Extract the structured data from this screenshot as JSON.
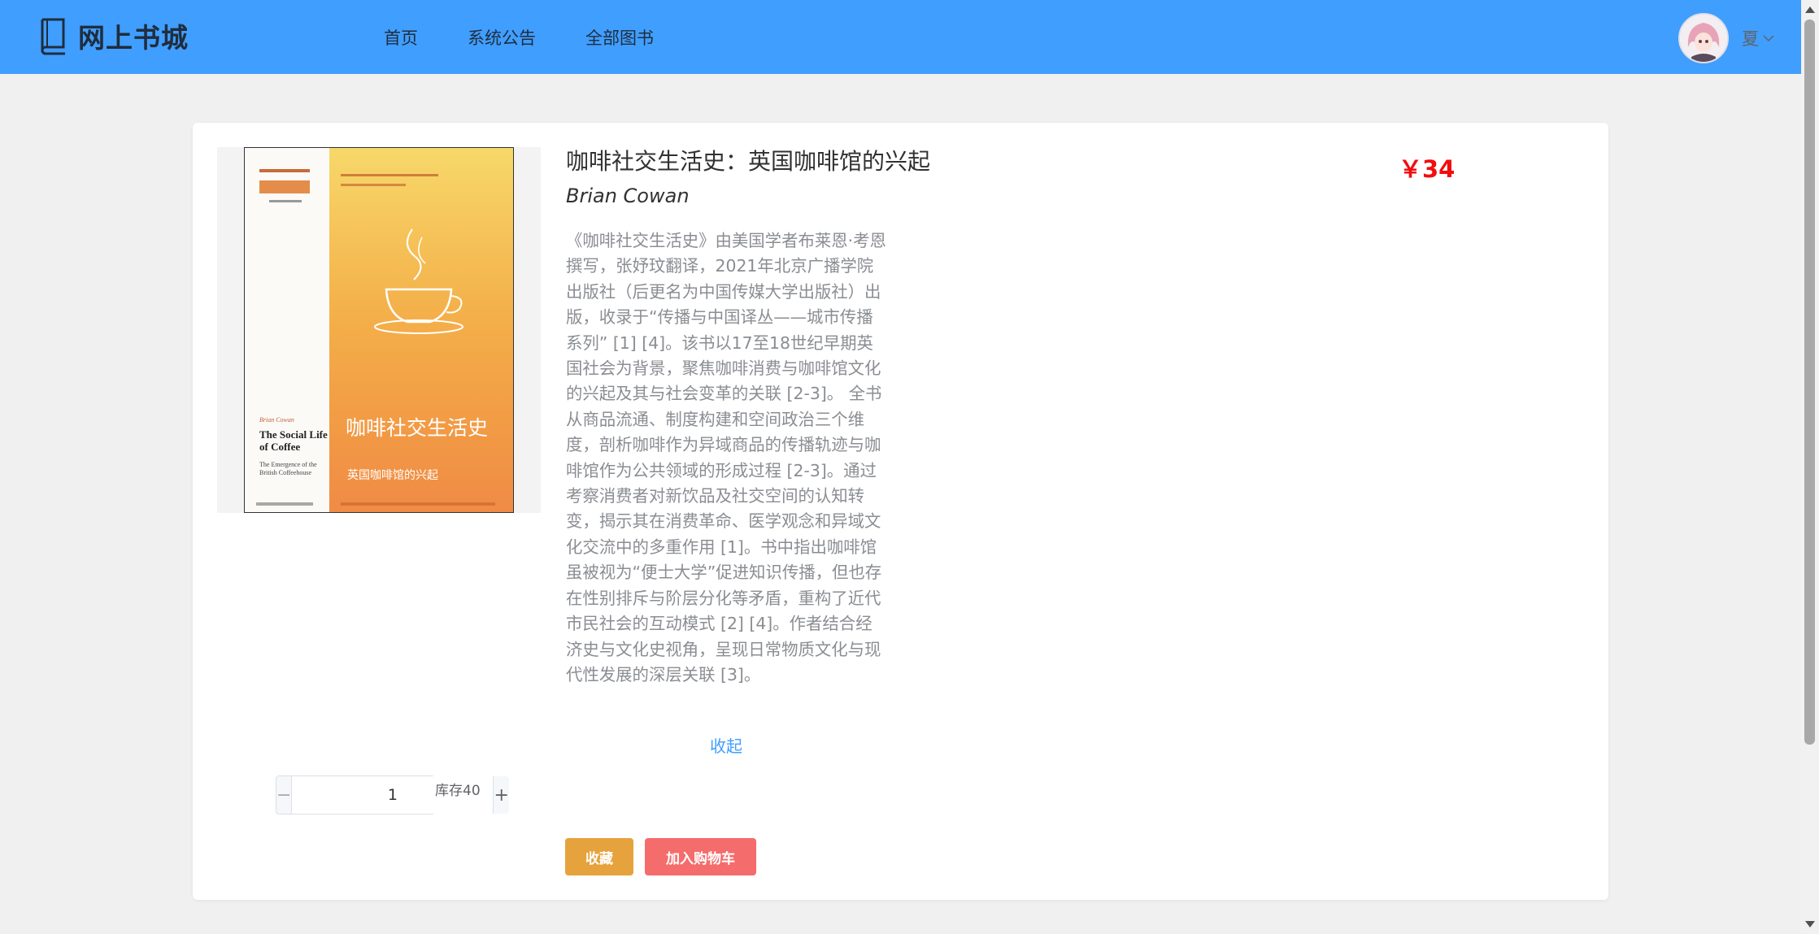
{
  "header": {
    "logo_text": "网上书城",
    "nav": [
      "首页",
      "系统公告",
      "全部图书"
    ],
    "user_name": "夏"
  },
  "book": {
    "title": "咖啡社交生活史：英国咖啡馆的兴起",
    "author": "Brian Cowan",
    "price": "￥34",
    "description": "《咖啡社交生活史》由美国学者布莱恩·考恩撰写，张妤玟翻译，2021年北京广播学院出版社（后更名为中国传媒大学出版社）出版，收录于“传播与中国译丛——城市传播系列” [1] [4]。该书以17至18世纪早期英国社会为背景，聚焦咖啡消费与咖啡馆文化的兴起及其与社会变革的关联 [2-3]。 全书从商品流通、制度构建和空间政治三个维度，剖析咖啡作为异域商品的传播轨迹与咖啡馆作为公共领域的形成过程 [2-3]。通过考察消费者对新饮品及社交空间的认知转变，揭示其在消费革命、医学观念和异域文化交流中的多重作用 [1]。书中指出咖啡馆虽被视为“便士大学”促进知识传播，但也存在性别排斥与阶层分化等矛盾，重构了近代市民社会的互动模式 [2] [4]。作者结合经济史与文化史视角，呈现日常物质文化与现代性发展的深层关联 [3]。",
    "collapse_label": "收起",
    "cover": {
      "cn_title": "咖啡社交生活史",
      "cn_subtitle": "英国咖啡馆的兴起",
      "en_title": "The Social Life of Coffee",
      "en_subtitle": "The Emergence of the British Coffeehouse",
      "en_author": "Brian Cowan"
    }
  },
  "quantity": {
    "value": "1",
    "minus": "−",
    "plus": "+",
    "stock_label": "库存40"
  },
  "actions": {
    "favorite": "收藏",
    "add_to_cart": "加入购物车"
  },
  "colors": {
    "header": "#409eff",
    "price": "#f20d0d",
    "favorite_button": "#e6a23c",
    "cart_button": "#f56c6c",
    "link": "#409eff"
  }
}
